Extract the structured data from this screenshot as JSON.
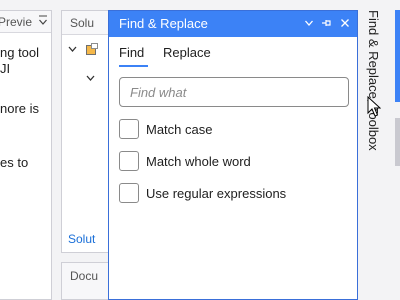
{
  "left_panel": {
    "tab_label": "Previe",
    "lines": [
      "ng tool",
      "JI",
      "nore is",
      "es to"
    ]
  },
  "solution_explorer": {
    "tab_label": "Solu",
    "footer_label": "Solut"
  },
  "docs_panel": {
    "tab_label": "Docu"
  },
  "find_replace": {
    "title": "Find & Replace",
    "tabs": [
      "Find",
      "Replace"
    ],
    "active_tab": "Find",
    "search": {
      "placeholder": "Find what",
      "value": ""
    },
    "options": [
      "Match case",
      "Match whole word",
      "Use regular expressions"
    ]
  },
  "toolbox_tab": {
    "label": "Find & Replace, Toolbox"
  },
  "colors": {
    "accent": "#3c82f6",
    "title_bar": "#3c82f6"
  }
}
